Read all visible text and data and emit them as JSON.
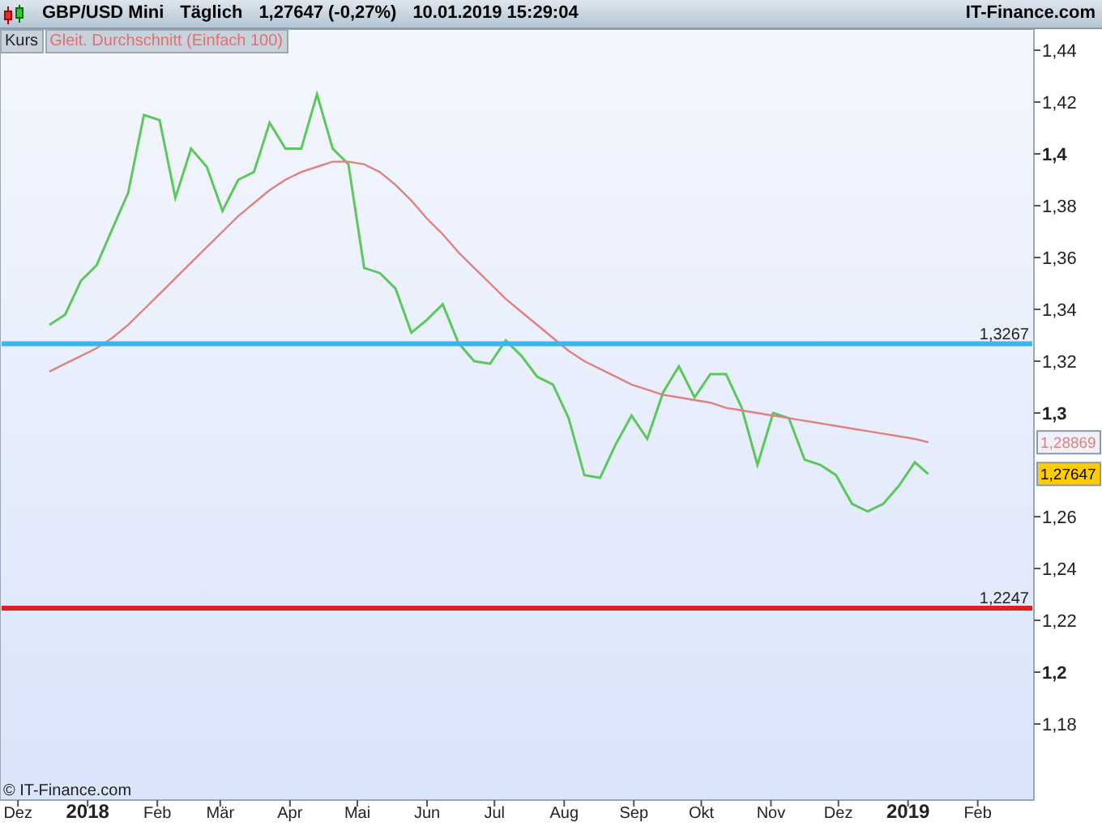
{
  "header": {
    "symbol": "GBP/USD Mini",
    "interval": "Täglich",
    "quote": "1,27647 (-0,27%)",
    "timestamp": "10.01.2019 15:29:04",
    "brand": "IT-Finance.com"
  },
  "legend": [
    {
      "color": "#222222"
    },
    {
      "color": "#e07070"
    }
  ],
  "price_tags": [
    {
      "label": "1,28869",
      "color": "#eef2f8"
    },
    {
      "label": "1,27647",
      "color": "#ffcc00"
    }
  ],
  "copyright": "© IT-Finance.com",
  "chart_data": {
    "type": "line",
    "x": [
      "2017-12-15",
      "2017-12-22",
      "2017-12-29",
      "2018-01-05",
      "2018-01-12",
      "2018-01-19",
      "2018-01-26",
      "2018-02-02",
      "2018-02-09",
      "2018-02-16",
      "2018-02-23",
      "2018-03-02",
      "2018-03-09",
      "2018-03-16",
      "2018-03-23",
      "2018-03-30",
      "2018-04-06",
      "2018-04-13",
      "2018-04-20",
      "2018-04-27",
      "2018-05-04",
      "2018-05-11",
      "2018-05-18",
      "2018-05-25",
      "2018-06-01",
      "2018-06-08",
      "2018-06-15",
      "2018-06-22",
      "2018-06-29",
      "2018-07-06",
      "2018-07-13",
      "2018-07-20",
      "2018-07-27",
      "2018-08-03",
      "2018-08-10",
      "2018-08-17",
      "2018-08-24",
      "2018-08-31",
      "2018-09-07",
      "2018-09-14",
      "2018-09-21",
      "2018-09-28",
      "2018-10-05",
      "2018-10-12",
      "2018-10-19",
      "2018-10-26",
      "2018-11-02",
      "2018-11-09",
      "2018-11-16",
      "2018-11-23",
      "2018-11-30",
      "2018-12-07",
      "2018-12-14",
      "2018-12-21",
      "2018-12-28",
      "2019-01-04",
      "2019-01-10"
    ],
    "series": [
      {
        "name": "Kurs",
        "color": "#5cc85c",
        "values": [
          1.334,
          1.338,
          1.351,
          1.357,
          1.371,
          1.385,
          1.415,
          1.413,
          1.383,
          1.402,
          1.395,
          1.378,
          1.39,
          1.393,
          1.412,
          1.402,
          1.402,
          1.423,
          1.402,
          1.396,
          1.356,
          1.354,
          1.348,
          1.331,
          1.336,
          1.342,
          1.327,
          1.32,
          1.319,
          1.328,
          1.322,
          1.314,
          1.311,
          1.298,
          1.276,
          1.275,
          1.288,
          1.299,
          1.29,
          1.308,
          1.318,
          1.306,
          1.315,
          1.315,
          1.302,
          1.28,
          1.3,
          1.298,
          1.282,
          1.28,
          1.276,
          1.265,
          1.262,
          1.265,
          1.272,
          1.281,
          1.27647
        ]
      },
      {
        "name": "Gleit. Durchschnitt (Einfach 100)",
        "color": "#e08080",
        "values": [
          1.316,
          1.319,
          1.322,
          1.325,
          1.329,
          1.334,
          1.34,
          1.346,
          1.352,
          1.358,
          1.364,
          1.37,
          1.376,
          1.381,
          1.386,
          1.39,
          1.393,
          1.395,
          1.397,
          1.397,
          1.396,
          1.393,
          1.388,
          1.382,
          1.375,
          1.369,
          1.362,
          1.356,
          1.35,
          1.344,
          1.339,
          1.334,
          1.329,
          1.324,
          1.32,
          1.317,
          1.314,
          1.311,
          1.309,
          1.307,
          1.306,
          1.305,
          1.304,
          1.302,
          1.301,
          1.3,
          1.299,
          1.298,
          1.297,
          1.296,
          1.295,
          1.294,
          1.293,
          1.292,
          1.291,
          1.29,
          1.28869
        ]
      }
    ],
    "xlim": [
      "2017-11-23",
      "2019-02-26"
    ],
    "ylim": [
      1.15063,
      1.44813
    ],
    "yticks": [
      {
        "value": 1.18,
        "label": "1,18"
      },
      {
        "value": 1.2,
        "label": "1,2"
      },
      {
        "value": 1.22,
        "label": "1,22"
      },
      {
        "value": 1.24,
        "label": "1,24"
      },
      {
        "value": 1.26,
        "label": "1,26"
      },
      {
        "value": 1.3,
        "label": "1,3"
      },
      {
        "value": 1.32,
        "label": "1,32"
      },
      {
        "value": 1.34,
        "label": "1,34"
      },
      {
        "value": 1.36,
        "label": "1,36"
      },
      {
        "value": 1.38,
        "label": "1,38"
      },
      {
        "value": 1.4,
        "label": "1,4"
      },
      {
        "value": 1.42,
        "label": "1,42"
      },
      {
        "value": 1.44,
        "label": "1,44"
      }
    ],
    "xticks": [
      {
        "value": "2017-12-01",
        "label": "Dez"
      },
      {
        "value": "2018-01-01",
        "label": "2018"
      },
      {
        "value": "2018-02-01",
        "label": "Feb"
      },
      {
        "value": "2018-03-01",
        "label": "Mär"
      },
      {
        "value": "2018-04-01",
        "label": "Apr"
      },
      {
        "value": "2018-05-01",
        "label": "Mai"
      },
      {
        "value": "2018-06-01",
        "label": "Jun"
      },
      {
        "value": "2018-07-01",
        "label": "Jul"
      },
      {
        "value": "2018-08-01",
        "label": "Aug"
      },
      {
        "value": "2018-09-01",
        "label": "Sep"
      },
      {
        "value": "2018-10-01",
        "label": "Okt"
      },
      {
        "value": "2018-11-01",
        "label": "Nov"
      },
      {
        "value": "2018-12-01",
        "label": "Dez"
      },
      {
        "value": "2019-01-01",
        "label": "2019"
      },
      {
        "value": "2019-02-01",
        "label": "Feb"
      }
    ],
    "ref_lines": [
      {
        "axis": "y",
        "value": 1.3267,
        "label": "1,3267",
        "color": "#3cb4f0"
      },
      {
        "axis": "y",
        "value": 1.2247,
        "label": "1,2247",
        "color": "#e02020"
      }
    ]
  }
}
